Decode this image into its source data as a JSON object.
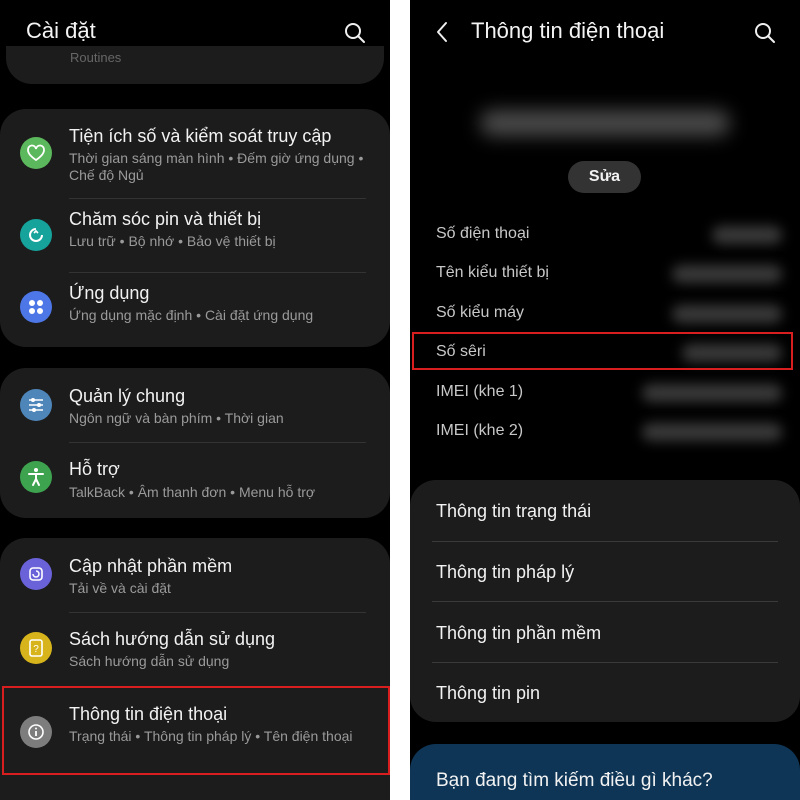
{
  "left": {
    "title": "Cài đặt",
    "top_partial_text": "Routines",
    "groups": [
      {
        "items": [
          {
            "title": "Tiện ích số và kiểm soát truy cập",
            "subtitle": "Thời gian sáng màn hình  •  Đếm giờ ứng dụng  •  Chế độ Ngủ",
            "icon": "digital-wellbeing-icon",
            "color": "#5cb85c"
          },
          {
            "title": "Chăm sóc pin và thiết bị",
            "subtitle": "Lưu trữ  •  Bộ nhớ  •  Bảo vệ thiết bị",
            "icon": "device-care-icon",
            "color": "#15a39b"
          },
          {
            "title": "Ứng dụng",
            "subtitle": "Ứng dụng mặc định  •  Cài đặt ứng dụng",
            "icon": "apps-icon",
            "color": "#4d76e6"
          }
        ]
      },
      {
        "items": [
          {
            "title": "Quản lý chung",
            "subtitle": "Ngôn ngữ và bàn phím  •  Thời gian",
            "icon": "sliders-icon",
            "color": "#4f86b9"
          },
          {
            "title": "Hỗ trợ",
            "subtitle": "TalkBack  •  Âm thanh đơn  •  Menu hỗ trợ",
            "icon": "accessibility-icon",
            "color": "#3ea34f"
          }
        ]
      },
      {
        "items": [
          {
            "title": "Cập nhật phần mềm",
            "subtitle": "Tải về và cài đặt",
            "icon": "software-update-icon",
            "color": "#6a62d9"
          },
          {
            "title": "Sách hướng dẫn sử dụng",
            "subtitle": "Sách hướng dẫn sử dụng",
            "icon": "user-manual-icon",
            "color": "#d7b41c"
          },
          {
            "title": "Thông tin điện thoại",
            "subtitle": "Trạng thái  •  Thông tin pháp lý  •  Tên điện thoại",
            "icon": "info-icon",
            "color": "#7d7d7d"
          }
        ]
      }
    ]
  },
  "right": {
    "title": "Thông tin điện thoại",
    "edit_label": "Sửa",
    "info_rows": [
      "Số điện thoại",
      "Tên kiểu thiết bị",
      "Số kiểu máy",
      "Số sêri",
      "IMEI (khe 1)",
      "IMEI (khe 2)"
    ],
    "menu": [
      "Thông tin trạng thái",
      "Thông tin pháp lý",
      "Thông tin phần mềm",
      "Thông tin pin"
    ],
    "bottom_prompt": "Bạn đang tìm kiếm điều gì khác?"
  },
  "colors": {
    "highlight": "#d81e1e",
    "card": "#1c1c1c",
    "prompt_card": "#0e3556"
  }
}
